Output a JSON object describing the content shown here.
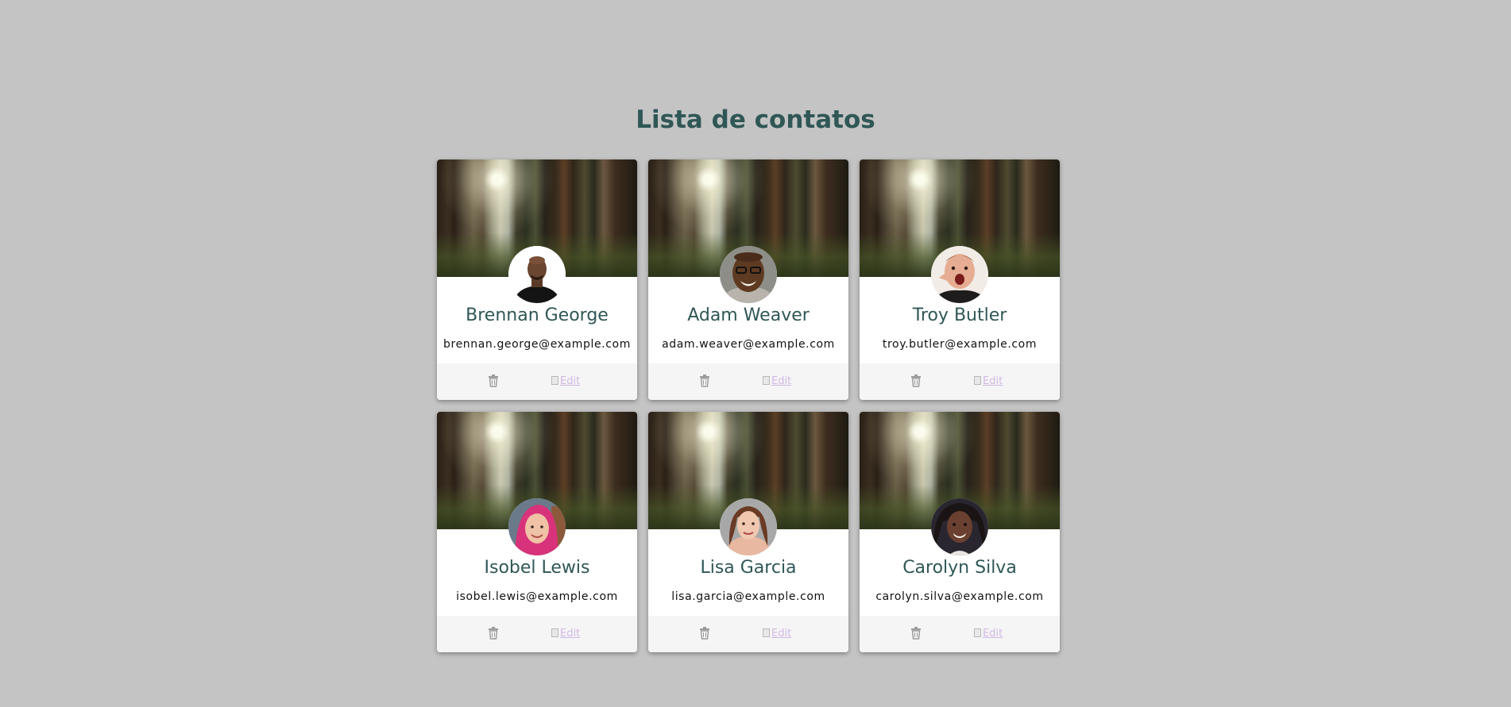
{
  "page": {
    "title": "Lista de contatos",
    "background_color": "#c4c4c4",
    "title_color": "#2f5756"
  },
  "contacts": [
    {
      "name": "Brennan George",
      "email": "brennan.george@example.com",
      "edit_label": "Edit",
      "avatar": "avatar-brennan-george"
    },
    {
      "name": "Adam Weaver",
      "email": "adam.weaver@example.com",
      "edit_label": "Edit",
      "avatar": "avatar-adam-weaver"
    },
    {
      "name": "Troy Butler",
      "email": "troy.butler@example.com",
      "edit_label": "Edit",
      "avatar": "avatar-troy-butler"
    },
    {
      "name": "Isobel Lewis",
      "email": "isobel.lewis@example.com",
      "edit_label": "Edit",
      "avatar": "avatar-isobel-lewis"
    },
    {
      "name": "Lisa Garcia",
      "email": "lisa.garcia@example.com",
      "edit_label": "Edit",
      "avatar": "avatar-lisa-garcia"
    },
    {
      "name": "Carolyn Silva",
      "email": "carolyn.silva@example.com",
      "edit_label": "Edit",
      "avatar": "avatar-carolyn-silva"
    }
  ],
  "icons": {
    "delete": "trash-icon",
    "edit": "broken-image-icon",
    "cover": "forest-cover-image"
  }
}
